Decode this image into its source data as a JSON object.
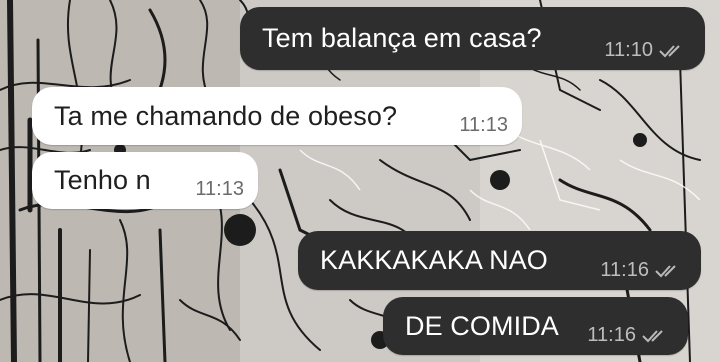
{
  "chat": {
    "messages": [
      {
        "direction": "out",
        "text": "Tem balança em casa?",
        "time": "11:10",
        "status_icon": "double-check-icon"
      },
      {
        "direction": "in",
        "text": "Ta me chamando de obeso?",
        "time": "11:13"
      },
      {
        "direction": "in",
        "text": "Tenho n",
        "time": "11:13"
      },
      {
        "direction": "out",
        "text": "KAKKAKAKA NAO",
        "time": "11:16",
        "status_icon": "double-check-icon"
      },
      {
        "direction": "out",
        "text": "DE COMIDA",
        "time": "11:16",
        "status_icon": "double-check-icon"
      }
    ]
  },
  "theme": {
    "outgoing_bubble": "#2e2e2e",
    "incoming_bubble": "#ffffff",
    "outgoing_time": "#bdbdbd",
    "incoming_time": "#6b6b6b",
    "tick_color": "#b9b9b9"
  }
}
